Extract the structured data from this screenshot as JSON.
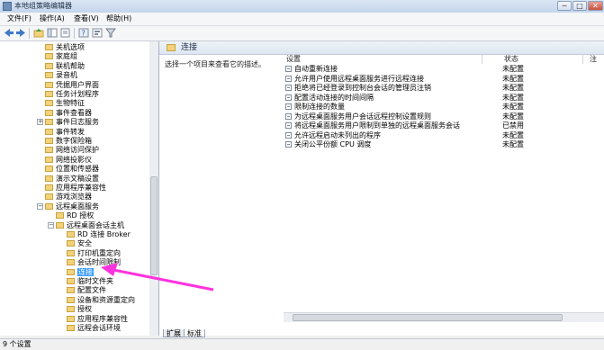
{
  "window": {
    "title": "本地组策略编辑器",
    "minimize": "─",
    "maximize": "□",
    "close": "✕"
  },
  "menu": [
    {
      "label": "文件(F)"
    },
    {
      "label": "操作(A)"
    },
    {
      "label": "查看(V)"
    },
    {
      "label": "帮助(H)"
    }
  ],
  "tree": [
    {
      "label": "关机选项",
      "indent": 1
    },
    {
      "label": "家庭组",
      "indent": 1
    },
    {
      "label": "联机帮助",
      "indent": 1
    },
    {
      "label": "录音机",
      "indent": 1
    },
    {
      "label": "凭据用户界面",
      "indent": 1
    },
    {
      "label": "任务计划程序",
      "indent": 1
    },
    {
      "label": "生物特征",
      "indent": 1
    },
    {
      "label": "事件查看器",
      "indent": 1
    },
    {
      "label": "事件日志服务",
      "indent": 1,
      "expander": "+"
    },
    {
      "label": "事件转发",
      "indent": 1
    },
    {
      "label": "数字保险箱",
      "indent": 1
    },
    {
      "label": "网络访问保护",
      "indent": 1
    },
    {
      "label": "网络投影仪",
      "indent": 1
    },
    {
      "label": "位置和传感器",
      "indent": 1
    },
    {
      "label": "演示文稿设置",
      "indent": 1
    },
    {
      "label": "应用程序兼容性",
      "indent": 1
    },
    {
      "label": "游戏浏览器",
      "indent": 1
    },
    {
      "label": "远程桌面服务",
      "indent": 1,
      "expander": "−"
    },
    {
      "label": "RD 授权",
      "indent": 2
    },
    {
      "label": "远程桌面会话主机",
      "indent": 2,
      "expander": "−"
    },
    {
      "label": "RD 连接 Broker",
      "indent": 3
    },
    {
      "label": "安全",
      "indent": 3
    },
    {
      "label": "打印机重定向",
      "indent": 3
    },
    {
      "label": "会话时间限制",
      "indent": 3
    },
    {
      "label": "连接",
      "indent": 3,
      "selected": true
    },
    {
      "label": "临时文件夹",
      "indent": 3
    },
    {
      "label": "配置文件",
      "indent": 3
    },
    {
      "label": "设备和资源重定向",
      "indent": 3
    },
    {
      "label": "授权",
      "indent": 3
    },
    {
      "label": "应用程序兼容性",
      "indent": 3
    },
    {
      "label": "远程会话环境",
      "indent": 3
    }
  ],
  "content": {
    "header": "连接",
    "description": "选择一个项目来查看它的描述。",
    "columns": {
      "setting": "设置",
      "state": "状态",
      "note": "注"
    },
    "policies": [
      {
        "name": "自动重新连接",
        "state": "未配置"
      },
      {
        "name": "允许用户使用远程桌面服务进行远程连接",
        "state": "未配置"
      },
      {
        "name": "拒绝将已经登录到控制台会话的管理员注销",
        "state": "未配置"
      },
      {
        "name": "配置活动连接的时间间隔",
        "state": "未配置"
      },
      {
        "name": "限制连接的数量",
        "state": "未配置"
      },
      {
        "name": "为远程桌面服务用户会话远程控制设置规则",
        "state": "未配置"
      },
      {
        "name": "将远程桌面服务用户限制到单独的远程桌面服务会话",
        "state": "已禁用"
      },
      {
        "name": "允许远程启动未列出的程序",
        "state": "未配置"
      },
      {
        "name": "关闭公平份额 CPU 调度",
        "state": "未配置"
      }
    ]
  },
  "tabs": [
    {
      "label": "扩展"
    },
    {
      "label": "标准"
    }
  ],
  "status": {
    "text": "9 个设置"
  },
  "colors": {
    "selection": "#3399ff",
    "arrow": "#ff33dd"
  }
}
